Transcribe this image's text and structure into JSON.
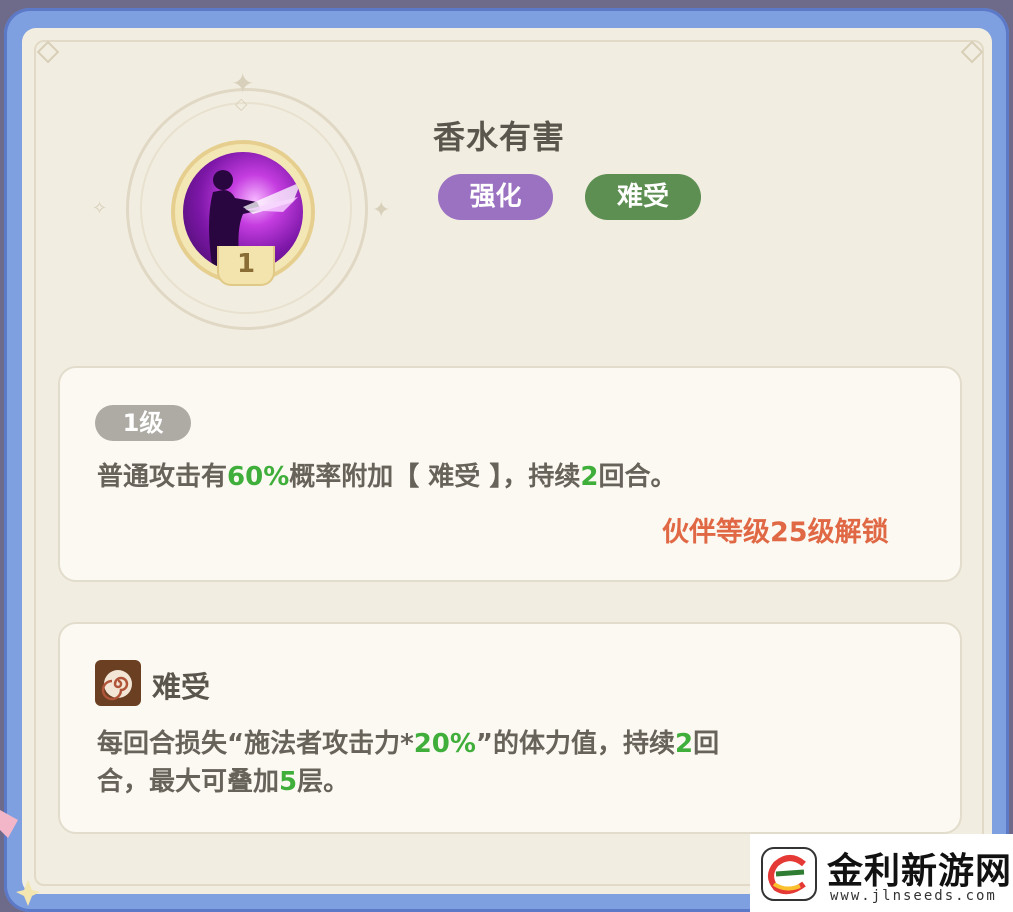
{
  "skill": {
    "name": "香水有害",
    "level": "1",
    "tags": {
      "buff": "强化",
      "debuff": "难受"
    },
    "colors": {
      "buff_tag": "#9b72c2",
      "debuff_tag": "#5d8e52",
      "highlight": "#3fae3a",
      "unlock": "#e06845"
    }
  },
  "level_card": {
    "level_label": "1级",
    "desc_parts": [
      "普通攻击有",
      "60%",
      "概率附加【 难受 】，持续",
      "2",
      "回合。"
    ],
    "unlock_text": "伙伴等级25级解锁"
  },
  "effect_card": {
    "icon": "swirl-debuff-icon",
    "name": "难受",
    "line1_parts": [
      "每回合损失“施法者攻击力*",
      "20%",
      "”的体力值，持续",
      "2",
      "回"
    ],
    "line2_parts": [
      "合，最大可叠加",
      "5",
      "层。"
    ]
  },
  "watermark": {
    "title": "金利新游网",
    "url": "www.jlnseeds.com"
  }
}
